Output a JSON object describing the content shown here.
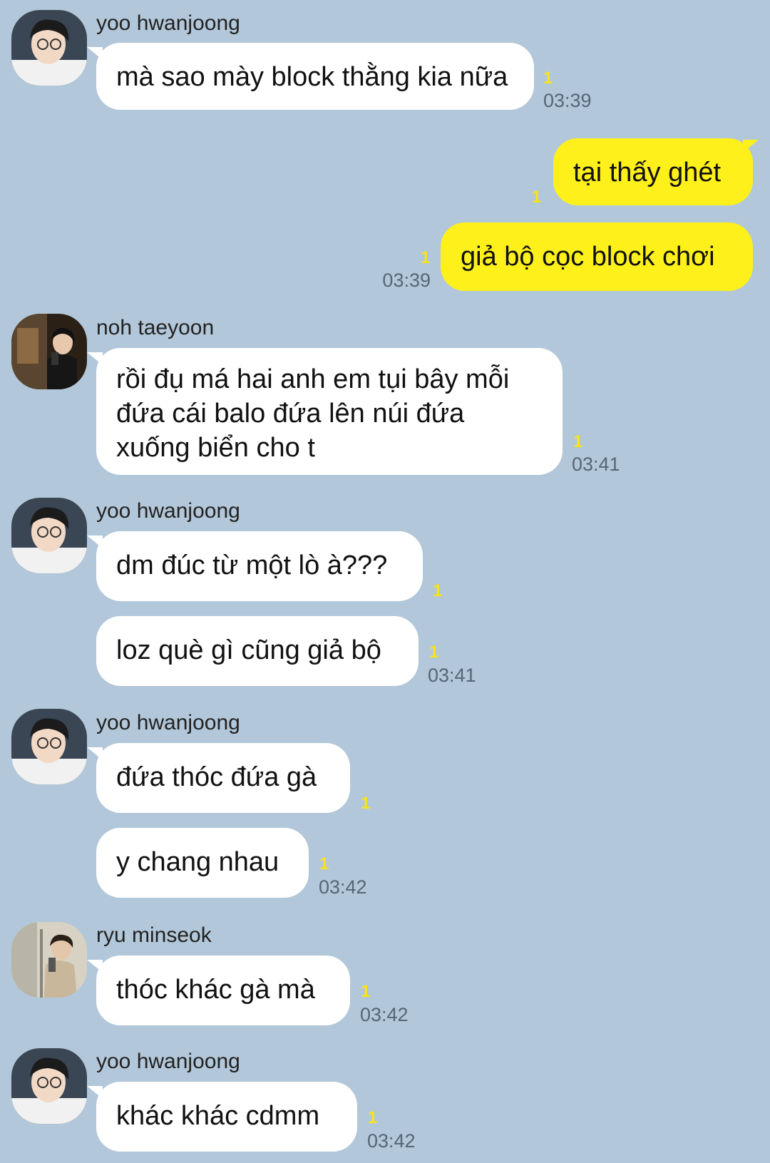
{
  "colors": {
    "background": "#b2c7d9",
    "incoming_bubble": "#ffffff",
    "outgoing_bubble": "#fef01b",
    "unread_count": "#f7e317",
    "timestamp": "#556677"
  },
  "messages": [
    {
      "sender": "yoo hwanjoong",
      "text": "mà sao mày block thằng kia nữa",
      "unread": "1",
      "time": "03:39"
    },
    {
      "text": "tại thấy ghét",
      "unread": "1"
    },
    {
      "text": "giả bộ cọc block chơi",
      "unread": "1",
      "time": "03:39"
    },
    {
      "sender": "noh taeyoon",
      "text": "rồi đụ má hai anh em tụi bây mỗi đứa cái balo đứa lên núi đứa xuống biển cho t",
      "unread": "1",
      "time": "03:41"
    },
    {
      "sender": "yoo hwanjoong",
      "text": "dm đúc từ một lò à???",
      "unread": "1"
    },
    {
      "text": "loz què gì cũng giả bộ",
      "unread": "1",
      "time": "03:41"
    },
    {
      "sender": "yoo hwanjoong",
      "text": "đứa thóc đứa gà",
      "unread": "1"
    },
    {
      "text": "y chang nhau",
      "unread": "1",
      "time": "03:42"
    },
    {
      "sender": "ryu minseok",
      "text": "thóc khác gà mà",
      "unread": "1",
      "time": "03:42"
    },
    {
      "sender": "yoo hwanjoong",
      "text": "khác khác cdmm",
      "unread": "1",
      "time": "03:42"
    }
  ]
}
